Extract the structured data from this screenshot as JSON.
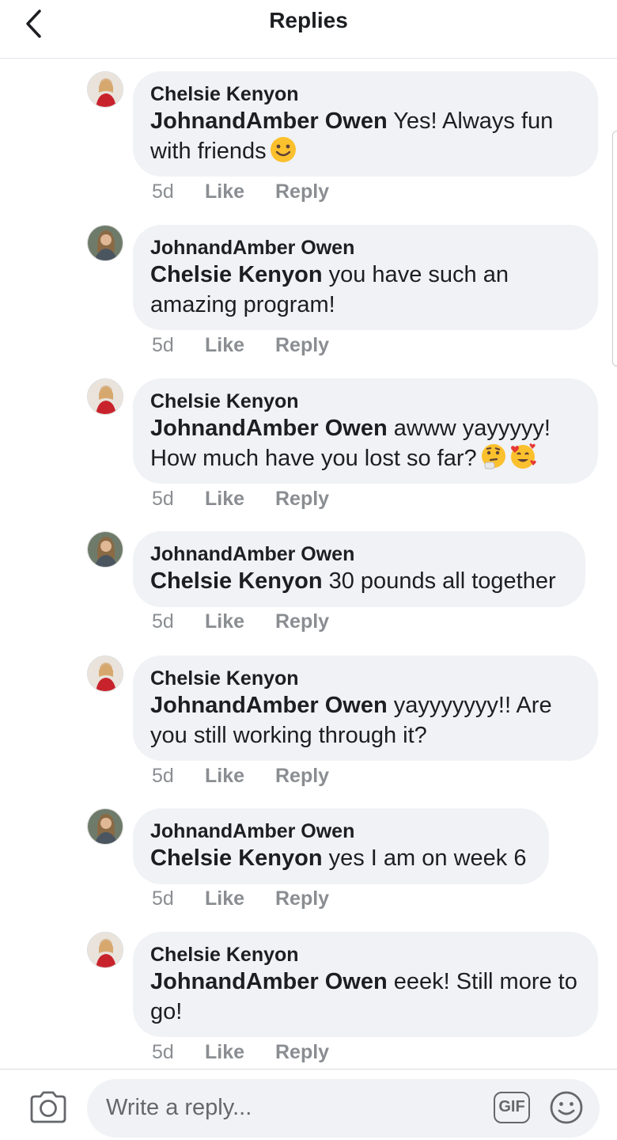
{
  "header": {
    "title": "Replies"
  },
  "comments": [
    {
      "author": "Chelsie Kenyon",
      "mention": "JohnandAmber Owen",
      "line1": " Yes! Always fun",
      "line2": "with friends",
      "age": "5d",
      "like": "Like",
      "reply": "Reply"
    },
    {
      "author": "JohnandAmber Owen",
      "mention": "Chelsie Kenyon",
      "line1": " you have such an",
      "line2": "amazing program!",
      "age": "5d",
      "like": "Like",
      "reply": "Reply"
    },
    {
      "author": "Chelsie Kenyon",
      "mention": "JohnandAmber Owen",
      "line1": " awww yayyyyy!",
      "line2": "How much have you lost so far?",
      "age": "5d",
      "like": "Like",
      "reply": "Reply"
    },
    {
      "author": "JohnandAmber Owen",
      "mention": "Chelsie Kenyon",
      "line1": " 30 pounds all together",
      "age": "5d",
      "like": "Like",
      "reply": "Reply"
    },
    {
      "author": "Chelsie Kenyon",
      "mention": "JohnandAmber Owen",
      "line1": " yayyyyyyy!!  Are",
      "line2": "you still working through it?",
      "age": "5d",
      "like": "Like",
      "reply": "Reply"
    },
    {
      "author": "JohnandAmber Owen",
      "mention": "Chelsie Kenyon",
      "line1": " yes I am on week 6",
      "age": "5d",
      "like": "Like",
      "reply": "Reply"
    },
    {
      "author": "Chelsie Kenyon",
      "mention": "JohnandAmber Owen",
      "line1": " eeek! Still more to",
      "line2": "go!",
      "age": "5d",
      "like": "Like",
      "reply": "Reply"
    }
  ],
  "composer": {
    "placeholder": "Write a reply...",
    "gif_label": "GIF"
  },
  "icons": {
    "back": "chevron-left-icon",
    "camera": "camera-icon",
    "gif": "gif-icon",
    "emoji_picker": "smiley-icon",
    "slightly_smiling": "slightly-smiling-face-emoji",
    "thinking": "thinking-face-emoji",
    "smiling_hearts": "smiling-face-with-hearts-emoji"
  },
  "colors": {
    "bubble": "#f0f2f5",
    "meta": "#8a8d91",
    "text": "#1c1e21"
  }
}
